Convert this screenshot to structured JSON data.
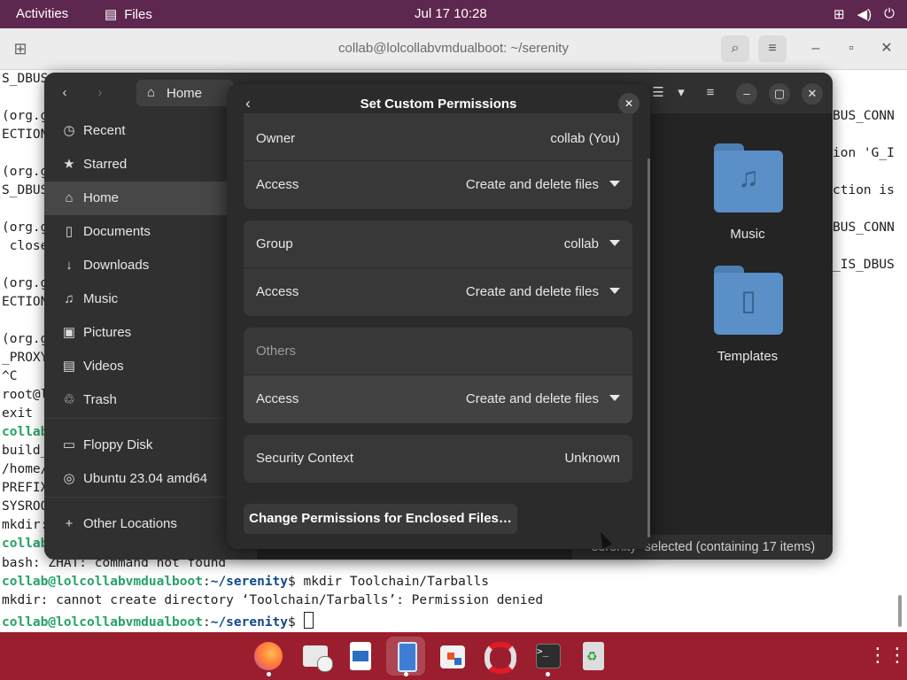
{
  "topbar": {
    "activities": "Activities",
    "app_menu": "Files",
    "clock": "Jul 17  10:28",
    "tray_icons": [
      "network-icon",
      "volume-icon",
      "power-icon"
    ]
  },
  "terminal": {
    "title": "collab@lolcollabvmdualboot: ~/serenity",
    "lines_left": [
      "S_DBUS",
      "",
      "(org.g",
      "ECTION",
      "",
      "(org.g",
      "S_DBUS",
      "",
      "(org.g",
      " close",
      "",
      "(org.g",
      "ECTION",
      "",
      "(org.g",
      "_PROXY",
      "^C",
      "root@l",
      "exit",
      "collab",
      "build_",
      "/home/",
      "PREFIX",
      "SYSROO",
      "mkdir:",
      "collab"
    ],
    "lines_right": [
      "BUS_CONN",
      "",
      "ion 'G_I",
      "",
      "ction is",
      "",
      "BUS_CONN",
      "",
      "_IS_DBUS"
    ],
    "bottom_lines": {
      "error1": "bash: ZHAT: command not found",
      "prompt_user": "collab@lolcollabvmdualboot",
      "prompt_path": "~/serenity",
      "command": "$ mkdir Toolchain/Tarballs",
      "error2": "mkdir: cannot create directory ‘Toolchain/Tarballs’: Permission denied",
      "prompt_end": "$ "
    }
  },
  "files": {
    "path_label": "Home",
    "sidebar": [
      {
        "label": "Recent",
        "icon": "clock-icon",
        "glyph": "◷"
      },
      {
        "label": "Starred",
        "icon": "star-icon",
        "glyph": "★"
      },
      {
        "label": "Home",
        "icon": "home-icon",
        "glyph": "⌂"
      },
      {
        "label": "Documents",
        "icon": "document-icon",
        "glyph": "▯"
      },
      {
        "label": "Downloads",
        "icon": "download-icon",
        "glyph": "↓"
      },
      {
        "label": "Music",
        "icon": "music-icon",
        "glyph": "♫"
      },
      {
        "label": "Pictures",
        "icon": "pictures-icon",
        "glyph": "▣"
      },
      {
        "label": "Videos",
        "icon": "videos-icon",
        "glyph": "▤"
      },
      {
        "label": "Trash",
        "icon": "trash-icon",
        "glyph": "♲"
      },
      {
        "label": "Floppy Disk",
        "icon": "floppy-icon",
        "glyph": "▭"
      },
      {
        "label": "Ubuntu 23.04 amd64",
        "icon": "disc-icon",
        "glyph": "◎"
      },
      {
        "label": "Other Locations",
        "icon": "plus-icon",
        "glyph": "+"
      }
    ],
    "folders": [
      {
        "label": "Music",
        "glyph": "♫"
      },
      {
        "label": "Templates",
        "glyph": "▯"
      }
    ],
    "status": "serenity” selected  (containing 17 items)"
  },
  "dialog": {
    "title": "Set Custom Permissions",
    "owner_label": "Owner",
    "owner_value": "collab (You)",
    "owner_access_label": "Access",
    "owner_access_value": "Create and delete files",
    "group_label": "Group",
    "group_value": "collab",
    "group_access_label": "Access",
    "group_access_value": "Create and delete files",
    "others_label": "Others",
    "others_access_label": "Access",
    "others_access_value": "Create and delete files",
    "security_label": "Security Context",
    "security_value": "Unknown",
    "enclosed_button": "Change Permissions for Enclosed Files…"
  },
  "dock": {
    "apps": [
      "firefox-icon",
      "mail-icon",
      "writer-icon",
      "files-icon",
      "software-icon",
      "help-icon",
      "terminal-icon",
      "recycle-icon"
    ],
    "show_apps_icon": "grid-icon",
    "colors": {
      "dock": "#9b1e2e",
      "topbar": "#5e2750"
    }
  }
}
